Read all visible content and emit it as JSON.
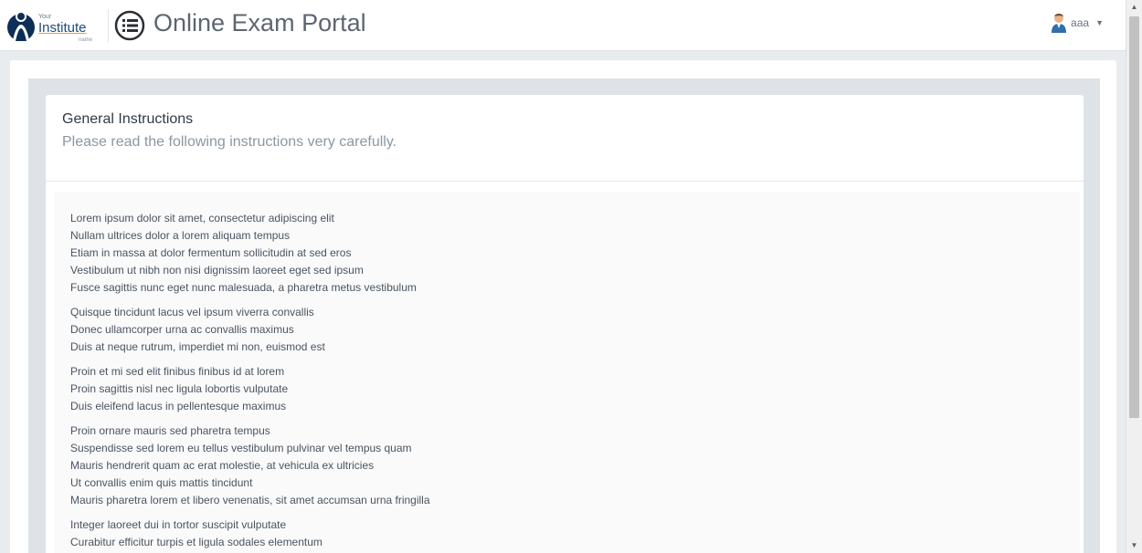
{
  "header": {
    "logo": {
      "your": "Your",
      "main": "Institute",
      "name": "name"
    },
    "title": "Online Exam Portal",
    "user": {
      "name": "aaa"
    },
    "menu_icon": "list-icon",
    "user_icon": "user-avatar-icon",
    "caret_icon": "caret-down-icon"
  },
  "panel": {
    "title": "General Instructions",
    "subtitle": "Please read the following instructions very carefully.",
    "paragraphs": [
      [
        "Lorem ipsum dolor sit amet, consectetur adipiscing elit",
        "Nullam ultrices dolor a lorem aliquam tempus",
        "Etiam in massa at dolor fermentum sollicitudin at sed eros",
        "Vestibulum ut nibh non nisi dignissim laoreet eget sed ipsum",
        "Fusce sagittis nunc eget nunc malesuada, a pharetra metus vestibulum"
      ],
      [
        "Quisque tincidunt lacus vel ipsum viverra convallis",
        "Donec ullamcorper urna ac convallis maximus",
        "Duis at neque rutrum, imperdiet mi non, euismod est"
      ],
      [
        "Proin et mi sed elit finibus finibus id at lorem",
        "Proin sagittis nisl nec ligula lobortis vulputate",
        "Duis eleifend lacus in pellentesque maximus"
      ],
      [
        "Proin ornare mauris sed pharetra tempus",
        "Suspendisse sed lorem eu tellus vestibulum pulvinar vel tempus quam",
        "Mauris hendrerit quam ac erat molestie, at vehicula ex ultricies",
        "Ut convallis enim quis mattis tincidunt",
        "Mauris pharetra lorem et libero venenatis, sit amet accumsan urna fringilla"
      ],
      [
        "Integer laoreet dui in tortor suscipit vulputate",
        "Curabitur efficitur turpis et ligula sodales elementum"
      ]
    ]
  },
  "colors": {
    "accent": "#1c4c7c",
    "page_bg": "#e9ecef",
    "frame": "#dfe3e7"
  }
}
